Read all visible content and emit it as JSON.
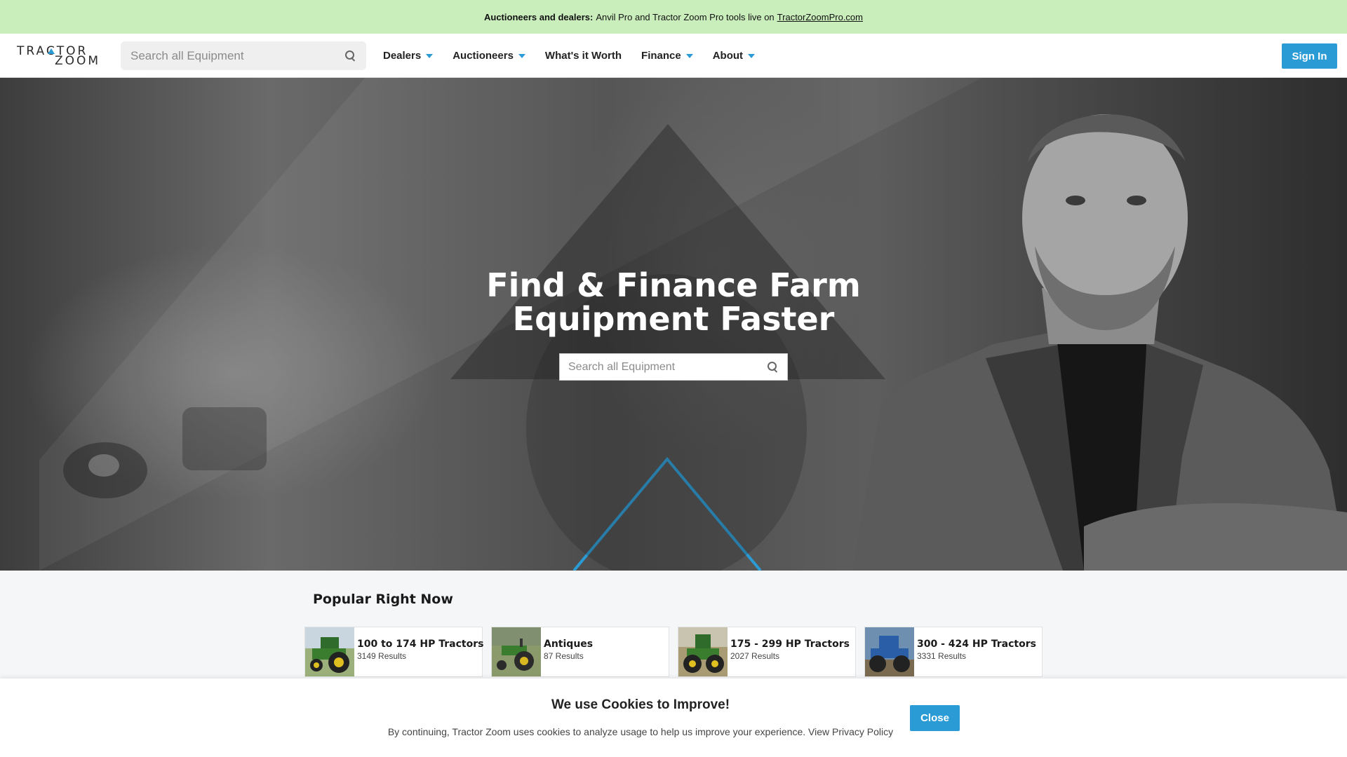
{
  "announcement": {
    "bold": "Auctioneers and dealers:",
    "text": "Anvil Pro and Tractor Zoom Pro tools live on",
    "link": "TractorZoomPro.com"
  },
  "header": {
    "logo_line1": "TRACTOR",
    "logo_line2": "ZOOM",
    "search_placeholder": "Search all Equipment",
    "nav": [
      {
        "label": "Dealers",
        "dropdown": true
      },
      {
        "label": "Auctioneers",
        "dropdown": true
      },
      {
        "label": "What's it Worth",
        "dropdown": false
      },
      {
        "label": "Finance",
        "dropdown": true
      },
      {
        "label": "About",
        "dropdown": true
      }
    ],
    "signin_label": "Sign In"
  },
  "hero": {
    "title_line1": "Find & Finance Farm",
    "title_line2": "Equipment Faster",
    "search_placeholder": "Search all Equipment"
  },
  "popular": {
    "title": "Popular Right Now",
    "items": [
      {
        "name": "100 to 174 HP Tractors",
        "count": "3149 Results"
      },
      {
        "name": "Antiques",
        "count": "87 Results"
      },
      {
        "name": "175 - 299 HP Tractors",
        "count": "2027 Results"
      },
      {
        "name": "300 - 424 HP Tractors",
        "count": "3331 Results"
      }
    ]
  },
  "cookie": {
    "title": "We use Cookies to Improve!",
    "text": "By continuing, Tractor Zoom uses cookies to analyze usage to help us improve your experience. View Privacy Policy",
    "close_label": "Close"
  },
  "colors": {
    "accent": "#2b9bd6",
    "announce_bg": "#c9eebb"
  }
}
